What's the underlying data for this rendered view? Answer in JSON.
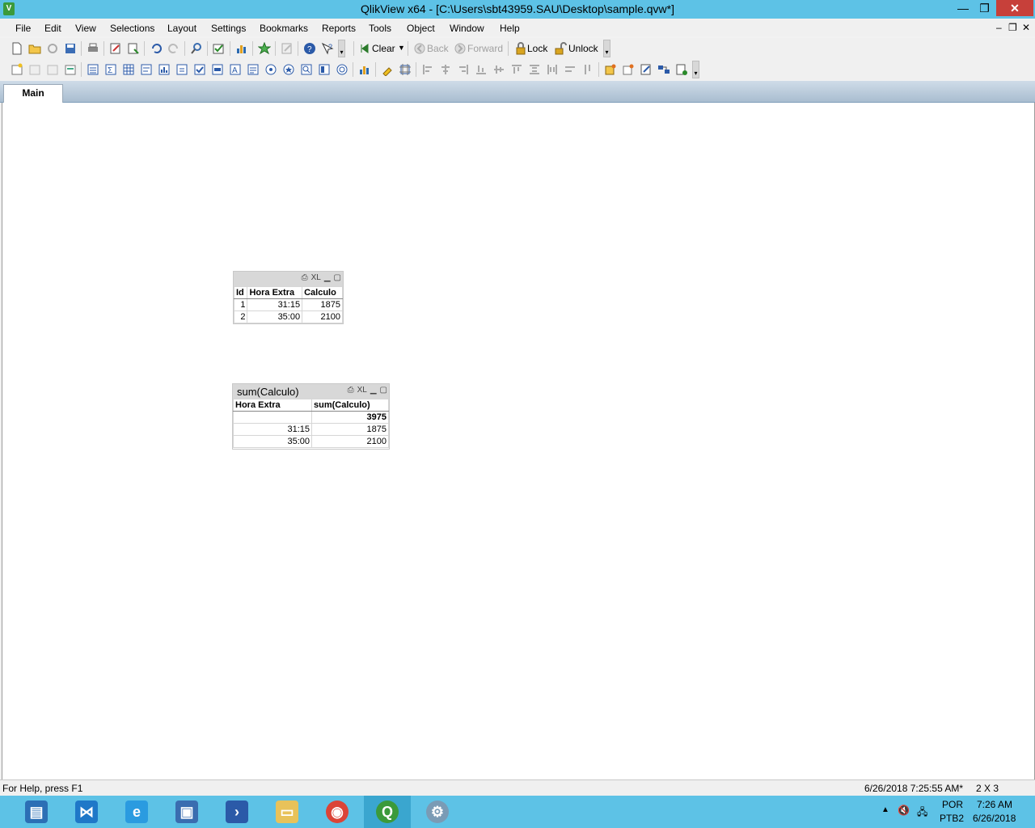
{
  "window": {
    "title": "QlikView x64 - [C:\\Users\\sbt43959.SAU\\Desktop\\sample.qvw*]",
    "logo_letter": "V",
    "minimize": "—",
    "restore": "❐",
    "close": "✕"
  },
  "menubar": {
    "items": [
      "File",
      "Edit",
      "View",
      "Selections",
      "Layout",
      "Settings",
      "Bookmarks",
      "Reports",
      "Tools",
      "Object",
      "Window",
      "Help"
    ],
    "mdi": [
      "–",
      "❐",
      "✕"
    ]
  },
  "toolbar1": {
    "clear_label": "Clear",
    "back_label": "Back",
    "forward_label": "Forward",
    "lock_label": "Lock",
    "unlock_label": "Unlock"
  },
  "tabs": {
    "main": "Main"
  },
  "table_box": {
    "caption_icons": [
      "print-icon",
      "xl-icon",
      "minimize-icon",
      "maximize-icon"
    ],
    "xl": "XL",
    "headers": [
      "Id",
      "Hora Extra",
      "Calculo"
    ],
    "rows": [
      [
        "1",
        "31:15",
        "1875"
      ],
      [
        "2",
        "35:00",
        "2100"
      ]
    ]
  },
  "straight_table": {
    "title": "sum(Calculo)",
    "xl": "XL",
    "headers": [
      "Hora Extra",
      "sum(Calculo)"
    ],
    "total": "3975",
    "rows": [
      [
        "31:15",
        "1875"
      ],
      [
        "35:00",
        "2100"
      ]
    ]
  },
  "statusbar": {
    "help": "For Help, press F1",
    "timestamp": "6/26/2018 7:25:55 AM*",
    "size": "2 X 3"
  },
  "taskbar": {
    "apps": [
      "server-manager",
      "visual-studio-code",
      "internet-explorer",
      "remote-desktop",
      "powershell",
      "file-explorer",
      "chrome",
      "qlikview",
      "settings"
    ],
    "lang": "POR",
    "layout": "PTB2",
    "time": "7:26 AM",
    "date": "6/26/2018"
  }
}
